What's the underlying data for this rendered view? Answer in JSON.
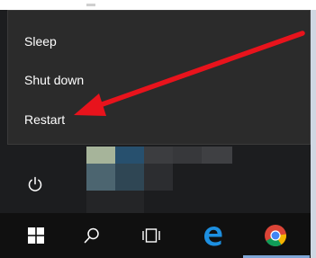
{
  "power_menu": {
    "items": [
      {
        "label": "Sleep"
      },
      {
        "label": "Shut down"
      },
      {
        "label": "Restart"
      }
    ]
  },
  "icons": {
    "power": "power-icon",
    "start": "windows-logo-icon",
    "search": "search-icon",
    "task_view": "task-view-icon",
    "edge": "edge-browser-icon",
    "chrome": "chrome-browser-icon",
    "annotation": "red-arrow-icon"
  },
  "colors": {
    "menu_bg": "#2b2b2b",
    "taskbar_bg": "#101010",
    "annotation_red": "#e8131c",
    "text": "#ffffff"
  }
}
